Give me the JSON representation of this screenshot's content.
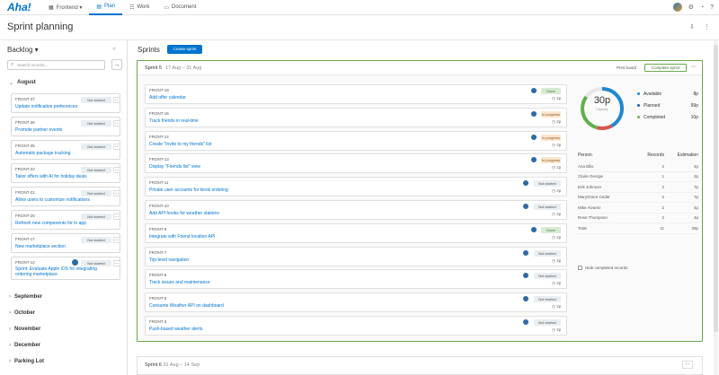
{
  "topbar": {
    "logo": "Aha!",
    "tabs": [
      {
        "label": "Frontend ▾",
        "icon": "boards-icon"
      },
      {
        "label": "Plan",
        "icon": "grid-icon"
      },
      {
        "label": "Work",
        "icon": "work-icon"
      },
      {
        "label": "Document",
        "icon": "doc-icon"
      }
    ],
    "icons": [
      "avatar",
      "settings-icon",
      "notifications-icon",
      "help-icon"
    ]
  },
  "page": {
    "title": "Sprint planning"
  },
  "backlog": {
    "title": "Backlog ▾",
    "search_placeholder": "Search records...",
    "new_button": "→",
    "current_month": "August",
    "records": [
      {
        "key": "FRONT-37",
        "name": "Update notification preferences",
        "status": "Not started"
      },
      {
        "key": "FRONT-36",
        "name": "Promote partner events",
        "status": "Not started"
      },
      {
        "key": "FRONT-35",
        "name": "Automatic package tracking",
        "status": "Not started"
      },
      {
        "key": "FRONT-22",
        "name": "Tailor offers with AI for holiday deals",
        "status": "Not started"
      },
      {
        "key": "FRONT-21",
        "name": "Allow users to customize notifications",
        "status": "Not started"
      },
      {
        "key": "FRONT-20",
        "name": "Refresh new components for in app",
        "status": "Not started"
      },
      {
        "key": "FRONT-17",
        "name": "New marketplace section",
        "status": "Not started"
      },
      {
        "key": "FRONT-12",
        "name": "Sprint: Evaluate Apple iOS for integrating ordering marketplace",
        "status": "Not started"
      }
    ],
    "months": [
      "September",
      "October",
      "November",
      "December",
      "Parking Lot"
    ]
  },
  "sprints": {
    "title": "Sprints",
    "create_button": "Create sprint",
    "current": {
      "name": "Sprint 5",
      "dates": "17 Aug – 31 Aug",
      "swap_button": "Print board",
      "complete_button": "Complete sprint",
      "records": [
        {
          "key": "FRONT-18",
          "name": "Add offer calendar",
          "status": "Done",
          "estimate": "2p"
        },
        {
          "key": "FRONT-15",
          "name": "Track friends in real-time",
          "status": "In progress",
          "estimate": "2p"
        },
        {
          "key": "FRONT-14",
          "name": "Create \"Invite to my friends\" list",
          "status": "In progress",
          "estimate": "2p"
        },
        {
          "key": "FRONT-13",
          "name": "Display \"Friends list\" view",
          "status": "In progress",
          "estimate": "2p"
        },
        {
          "key": "FRONT-11",
          "name": "Private user accounts for kiosk ordering",
          "status": "Not started",
          "estimate": "2p"
        },
        {
          "key": "FRONT-10",
          "name": "Add API hooks for weather stations",
          "status": "Not started",
          "estimate": "2p"
        },
        {
          "key": "FRONT-9",
          "name": "Integrate with Friend location API",
          "status": "Done",
          "estimate": "2p"
        },
        {
          "key": "FRONT-7",
          "name": "Top-level navigation",
          "status": "Not started",
          "estimate": "2p"
        },
        {
          "key": "FRONT-6",
          "name": "Track issues and maintenance",
          "status": "Not started",
          "estimate": "2p"
        },
        {
          "key": "FRONT-5",
          "name": "Consume Weather API on dashboard",
          "status": "Not started",
          "estimate": "2p"
        },
        {
          "key": "FRONT-3",
          "name": "Push-based weather alerts",
          "status": "Not started",
          "estimate": "2p"
        }
      ],
      "capacity": {
        "value": "30p",
        "label": "Capacity",
        "fraction": 0.85
      },
      "legend": [
        {
          "label": "Available",
          "value": "8p",
          "color": "#1e88d2"
        },
        {
          "label": "Planned",
          "value": "99p",
          "color": "#0f66b3"
        },
        {
          "label": "Completed",
          "value": "10p",
          "color": "#5fb14b"
        }
      ],
      "table_headers": [
        "Person",
        "Records",
        "Estimation"
      ],
      "people": [
        {
          "name": "Ana Ellis",
          "records": "2",
          "estimation": "4p"
        },
        {
          "name": "Claire George",
          "records": "1",
          "estimation": "2p"
        },
        {
          "name": "Erik Johnson",
          "records": "2",
          "estimation": "7p"
        },
        {
          "name": "MaryGrace Cedar",
          "records": "2",
          "estimation": "7p"
        },
        {
          "name": "Mike Alvarez",
          "records": "2",
          "estimation": "4p"
        },
        {
          "name": "Rose Thompson",
          "records": "2",
          "estimation": "4p"
        },
        {
          "name": "Total",
          "records": "11",
          "estimation": "29p"
        }
      ],
      "hide_label": "Hide completed records"
    },
    "next": {
      "name": "Sprint 6",
      "dates": "31 Aug – 14 Sep"
    }
  }
}
